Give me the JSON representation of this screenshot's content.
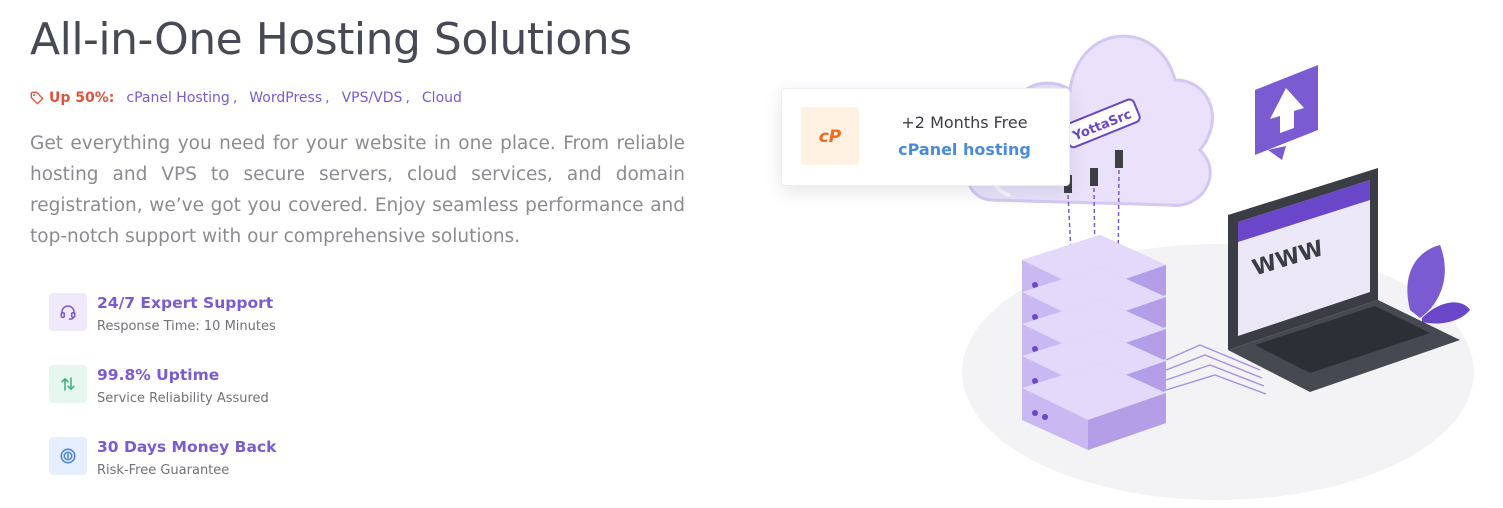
{
  "hero": {
    "title": "All-in-One Hosting Solutions",
    "discount_label": "Up 50%:",
    "services": [
      "cPanel Hosting",
      "WordPress",
      "VPS/VDS",
      "Cloud"
    ],
    "description": "Get everything you need for your website in one place. From reliable hosting and VPS to secure servers, cloud services, and domain registration, we’ve got you covered. Enjoy seamless performance and top-notch support with our comprehensive solutions."
  },
  "features": [
    {
      "title": "24/7 Expert Support",
      "subtitle": "Response Time: 10 Minutes",
      "icon": "headset-icon",
      "accent": "#7b5bd1"
    },
    {
      "title": "99.8% Uptime",
      "subtitle": "Service Reliability Assured",
      "icon": "updown-arrows-icon",
      "accent": "#3bb27a"
    },
    {
      "title": "30 Days Money Back",
      "subtitle": "Risk-Free Guarantee",
      "icon": "money-back-icon",
      "accent": "#4a7fdc"
    }
  ],
  "promo_card": {
    "line1": "+2 Months Free",
    "line2": "cPanel hosting",
    "logo_text": "cP"
  },
  "illustration": {
    "cloud_brand": "YottaSrc",
    "screen_text": "WWW"
  },
  "colors": {
    "title": "#474a54",
    "accent_purple": "#7b5bd1",
    "discount_red": "#e0533b",
    "cpanel_blue": "#4a8bdc",
    "cpanel_orange": "#f26a21"
  }
}
